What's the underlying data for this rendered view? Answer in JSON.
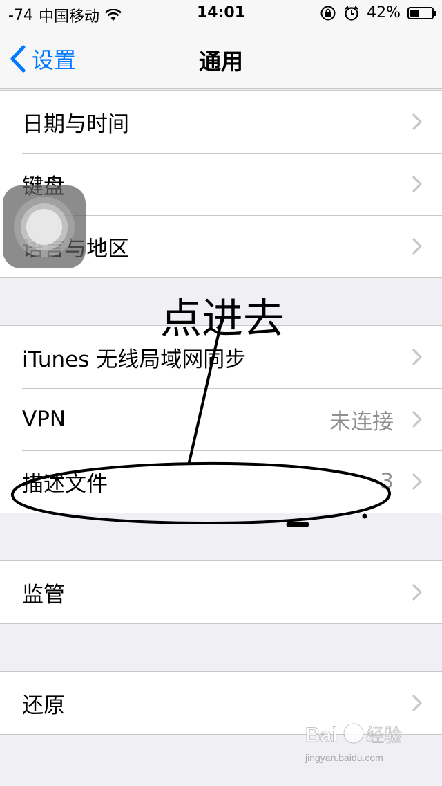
{
  "status_bar": {
    "signal": "-74",
    "carrier": "中国移动",
    "time": "14:01",
    "battery_percent": "42%",
    "battery_level": 0.42
  },
  "nav": {
    "back_label": "设置",
    "title": "通用"
  },
  "groups": [
    {
      "rows": [
        {
          "label": "日期与时间",
          "detail": ""
        },
        {
          "label": "键盘",
          "detail": ""
        },
        {
          "label": "语言与地区",
          "detail": ""
        }
      ]
    },
    {
      "rows": [
        {
          "label": "iTunes 无线局域网同步",
          "detail": ""
        },
        {
          "label": "VPN",
          "detail": "未连接"
        },
        {
          "label": "描述文件",
          "detail": "3"
        }
      ]
    },
    {
      "rows": [
        {
          "label": "监管",
          "detail": ""
        }
      ]
    },
    {
      "rows": [
        {
          "label": "还原",
          "detail": ""
        }
      ]
    }
  ],
  "annotation": {
    "text": "点进去"
  },
  "watermark": {
    "text": "Bai 经验",
    "sub": "jingyan.baidu.com"
  },
  "colors": {
    "accent": "#007aff",
    "background": "#efeff4",
    "separator": "#c8c7cc",
    "detail": "#8e8e93"
  }
}
